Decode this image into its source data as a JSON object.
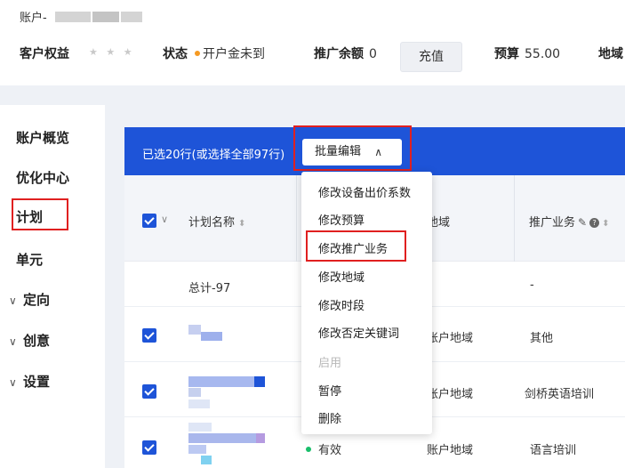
{
  "header": {
    "account_label": "账户-",
    "customer_rights_label": "客户权益",
    "stars": "★ ★ ★",
    "status_label": "状态",
    "status_value": "开户金未到",
    "promo_balance_label": "推广余额",
    "promo_balance_value": "0",
    "recharge_button": "充值",
    "budget_label": "预算",
    "budget_value": "55.00",
    "region_label": "地域"
  },
  "sidebar": {
    "items": [
      {
        "label": "账户概览"
      },
      {
        "label": "优化中心"
      },
      {
        "label": "计划"
      },
      {
        "label": "单元"
      },
      {
        "label": "定向"
      },
      {
        "label": "创意"
      },
      {
        "label": "设置"
      }
    ]
  },
  "toolbar": {
    "selection_text": "已选20行(或选择全部97行)",
    "batch_edit_button": "批量编辑"
  },
  "table": {
    "headers": {
      "plan_name": "计划名称",
      "region": "地域",
      "promo_business": "推广业务"
    },
    "total_row": {
      "label": "总计-97",
      "promo_business": "-"
    },
    "rows": [
      {
        "status": "",
        "region": "账户地域",
        "promo_business": "其他"
      },
      {
        "status": "",
        "region": "账户地域",
        "promo_business": "剑桥英语培训"
      },
      {
        "status": "有效",
        "region": "账户地域",
        "promo_business": "语言培训"
      }
    ]
  },
  "dropdown": {
    "items": [
      {
        "label": "修改设备出价系数",
        "enabled": true
      },
      {
        "label": "修改预算",
        "enabled": true
      },
      {
        "label": "修改推广业务",
        "enabled": true
      },
      {
        "label": "修改地域",
        "enabled": true
      },
      {
        "label": "修改时段",
        "enabled": true
      },
      {
        "label": "修改否定关键词",
        "enabled": true
      },
      {
        "label": "启用",
        "enabled": false
      },
      {
        "label": "暂停",
        "enabled": true
      },
      {
        "label": "删除",
        "enabled": true
      }
    ]
  },
  "colors": {
    "accent_blue": "#1e54d8",
    "highlight_red": "#e02020",
    "status_orange": "#f59a23",
    "status_green": "#19be6b"
  }
}
